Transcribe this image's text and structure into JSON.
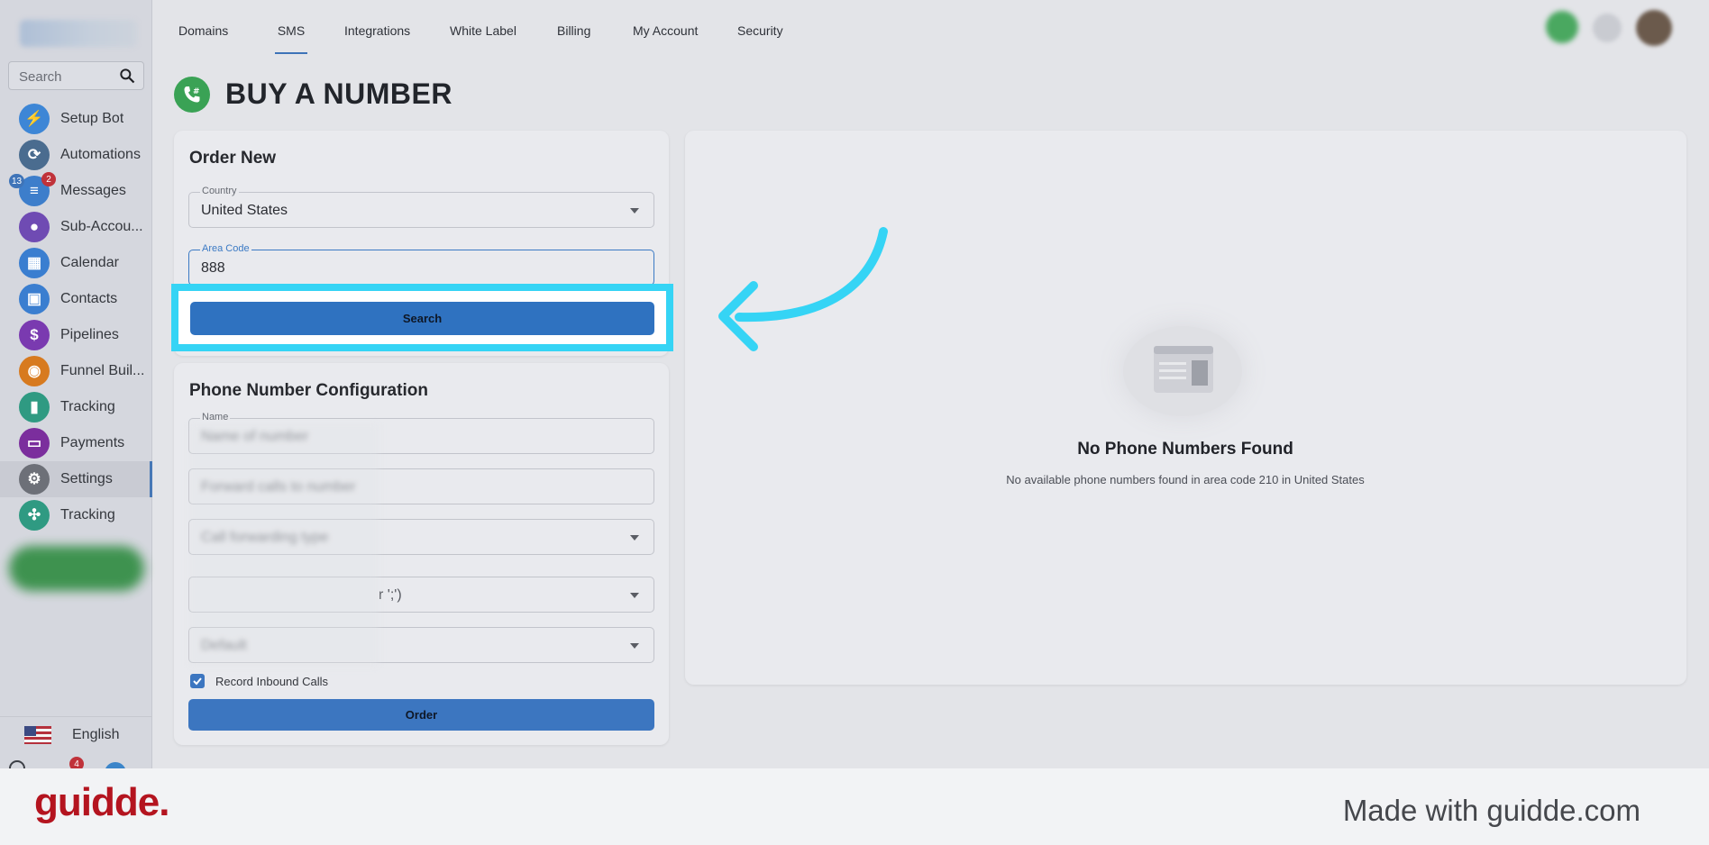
{
  "sidebar": {
    "search_placeholder": "Search",
    "items": [
      {
        "label": "Setup Bot",
        "icon": "bolt-icon",
        "color": "#3d86d6"
      },
      {
        "label": "Automations",
        "icon": "automation-icon",
        "color": "#4a6c8f"
      },
      {
        "label": "Messages",
        "icon": "chat-icon",
        "color": "#3d7ecb",
        "badge_left": "13",
        "badge_right": "2"
      },
      {
        "label": "Sub-Accou...",
        "icon": "user-icon",
        "color": "#6f4bb3"
      },
      {
        "label": "Calendar",
        "icon": "calendar-icon",
        "color": "#3a7ed0"
      },
      {
        "label": "Contacts",
        "icon": "contacts-icon",
        "color": "#3a7ed0"
      },
      {
        "label": "Pipelines",
        "icon": "dollar-icon",
        "color": "#7a3ab0"
      },
      {
        "label": "Funnel Buil...",
        "icon": "funnel-icon",
        "color": "#d77a1f"
      },
      {
        "label": "Tracking",
        "icon": "chart-icon",
        "color": "#2f9a82"
      },
      {
        "label": "Payments",
        "icon": "card-icon",
        "color": "#7b2e9d"
      },
      {
        "label": "Settings",
        "icon": "gear-icon",
        "color": "#6d7078"
      },
      {
        "label": "Tracking",
        "icon": "network-icon",
        "color": "#2f9a82"
      }
    ],
    "language": "English",
    "bottom_badge": "4"
  },
  "topnav": {
    "tabs": [
      "Domains",
      "SMS",
      "Integrations",
      "White Label",
      "Billing",
      "My Account",
      "Security"
    ],
    "active_tab": "SMS"
  },
  "page": {
    "title": "BUY A NUMBER"
  },
  "order": {
    "title": "Order New",
    "country_label": "Country",
    "country_value": "United States",
    "area_code_label": "Area Code",
    "area_code_value": "888",
    "search_button": "Search"
  },
  "config": {
    "title": "Phone Number Configuration",
    "name_label": "Name",
    "name_value": "Name of number",
    "field2_value": "Forward calls to number",
    "field3_value": "Call forwarding type",
    "field4_visible": "r ';')",
    "field5_value": "Default",
    "record_label": "Record Inbound Calls",
    "order_button": "Order"
  },
  "empty": {
    "title": "No Phone Numbers Found",
    "subtitle": "No available phone numbers found in area code 210 in United States"
  },
  "footer": {
    "brand": "guidde.",
    "made_with": "Made with guidde.com"
  }
}
